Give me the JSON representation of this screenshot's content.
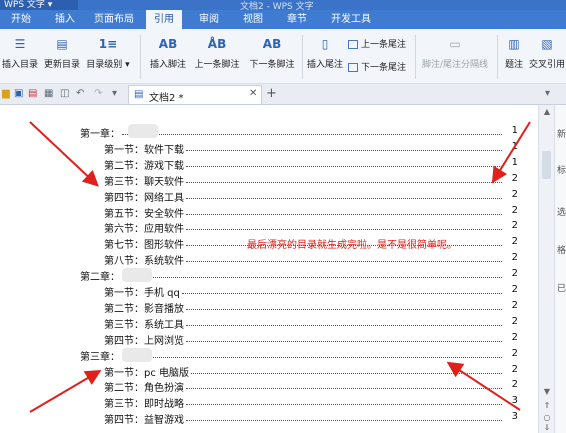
{
  "window": {
    "app_name": "WPS 文字",
    "title": "文档2 - WPS 文字"
  },
  "menu": {
    "items": [
      "开始",
      "插入",
      "页面布局",
      "引用",
      "审阅",
      "视图",
      "章节",
      "开发工具"
    ],
    "active": "引用"
  },
  "ribbon": {
    "insert_toc": "插入目录",
    "update_toc": "更新目录",
    "toc_level": "目录级别",
    "insert_footnote": "插入脚注",
    "prev_footnote": "上一条脚注",
    "next_footnote": "下一条脚注",
    "insert_endnote": "插入尾注",
    "prev_endnote": "上一条尾注",
    "next_endnote": "下一条尾注",
    "separator_line": "脚注/尾注分隔线",
    "caption": "题注",
    "cross_ref": "交叉引用"
  },
  "tabs": {
    "doc_tab": "文档2 *"
  },
  "toc": [
    {
      "label": "第一章：",
      "page": "1",
      "level": 1
    },
    {
      "label": "第一节：软件下载",
      "page": "1",
      "level": 2
    },
    {
      "label": "第二节：游戏下载",
      "page": "1",
      "level": 2
    },
    {
      "label": "第三节：聊天软件",
      "page": "2",
      "level": 2
    },
    {
      "label": "第四节：网络工具",
      "page": "2",
      "level": 2
    },
    {
      "label": "第五节：安全软件",
      "page": "2",
      "level": 2
    },
    {
      "label": "第六节：应用软件",
      "page": "2",
      "level": 2
    },
    {
      "label": "第七节：图形软件",
      "page": "2",
      "level": 2
    },
    {
      "label": "第八节：系统软件",
      "page": "2",
      "level": 2
    },
    {
      "label": "第二章：",
      "page": "2",
      "level": 1
    },
    {
      "label": "第一节：手机 qq",
      "page": "2",
      "level": 2
    },
    {
      "label": "第二节：影音播放",
      "page": "2",
      "level": 2
    },
    {
      "label": "第三节：系统工具",
      "page": "2",
      "level": 2
    },
    {
      "label": "第四节：上网浏览",
      "page": "2",
      "level": 2
    },
    {
      "label": "第三章：",
      "page": "2",
      "level": 1
    },
    {
      "label": "第一节：pc 电脑版",
      "page": "2",
      "level": 2
    },
    {
      "label": "第二节：角色扮演",
      "page": "2",
      "level": 2
    },
    {
      "label": "第三节：即时战略",
      "page": "3",
      "level": 2
    },
    {
      "label": "第四节：益智游戏",
      "page": "3",
      "level": 2
    }
  ],
  "annotation": "最后漂亮的目录就生成完啦。是不是很简单呢。",
  "side_labels": [
    "新",
    "标",
    "选",
    "格",
    "已"
  ],
  "colors": {
    "title_bar": "#3a73c8",
    "menu_bar": "#3f7bd1",
    "annotation": "#e0201a",
    "arrow": "#e0201a"
  }
}
